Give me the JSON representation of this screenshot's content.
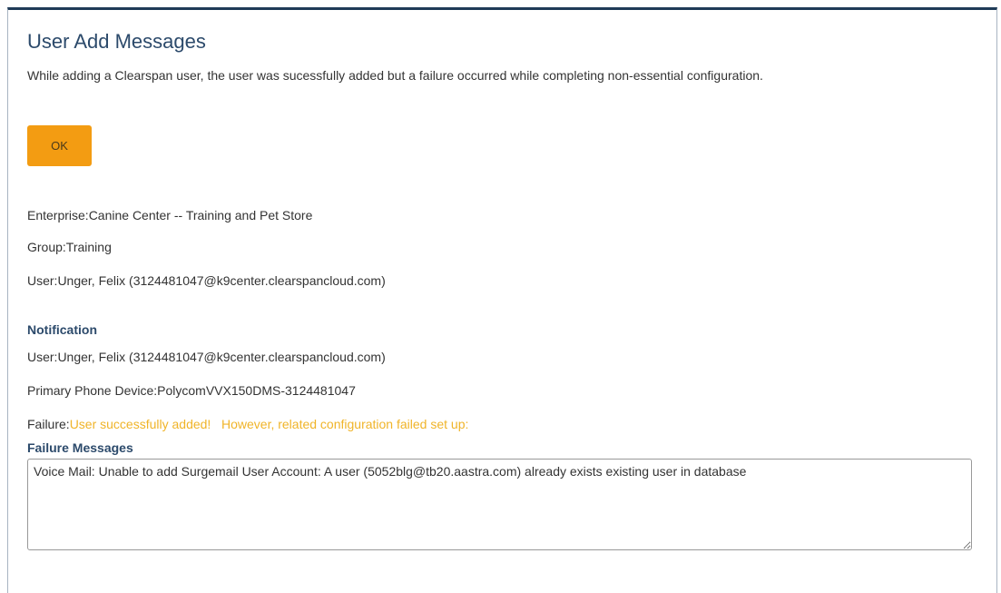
{
  "dialog": {
    "title": "User Add Messages",
    "intro": "While adding a Clearspan user, the user was sucessfully added but a failure occurred while completing non-essential configuration.",
    "ok_label": "OK"
  },
  "details": {
    "enterprise": "Enterprise:Canine Center -- Training and Pet Store",
    "group": "Group:Training",
    "user": "User:Unger, Felix (3124481047@k9center.clearspancloud.com)"
  },
  "notification": {
    "heading": "Notification",
    "user": "User:Unger, Felix (3124481047@k9center.clearspancloud.com)",
    "device": "Primary Phone Device:PolycomVVX150DMS-3124481047",
    "failure_label": "Failure:",
    "failure_value": "User successfully added!   However, related configuration failed set up:"
  },
  "failure_messages": {
    "heading": "Failure Messages",
    "text": "Voice Mail: Unable to add Surgemail User Account: A user (5052blg@tb20.aastra.com) already exists existing user in database"
  },
  "colors": {
    "title": "#2c4a6b",
    "ok_button": "#f39c12",
    "failure_text": "#f0b429",
    "border_top": "#1f3b57"
  }
}
